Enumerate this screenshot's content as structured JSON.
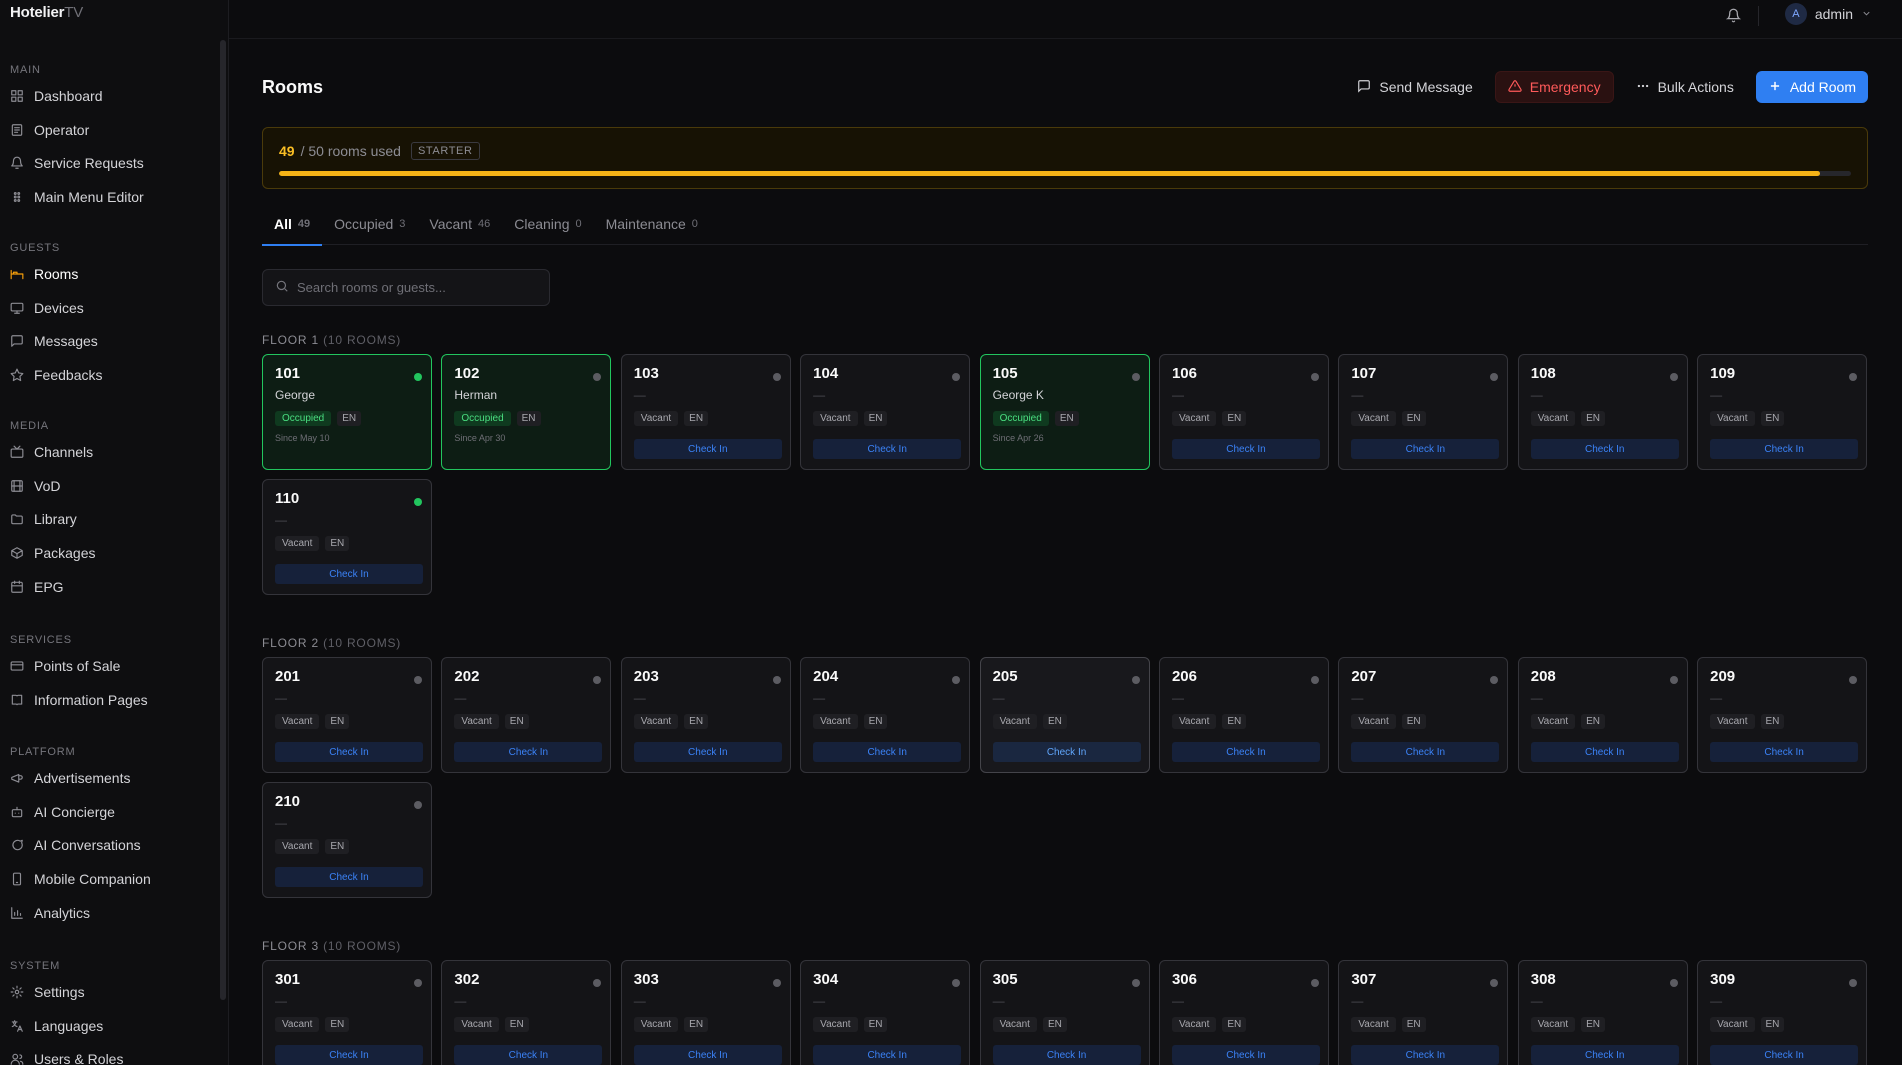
{
  "brand": {
    "name": "Hotelier",
    "suffix": "TV"
  },
  "sidebar": {
    "sections": [
      {
        "title": "MAIN",
        "items": [
          {
            "label": "Dashboard",
            "icon": "dashboard-icon"
          },
          {
            "label": "Operator",
            "icon": "operator-icon"
          },
          {
            "label": "Service Requests",
            "icon": "bell-icon"
          },
          {
            "label": "Main Menu Editor",
            "icon": "grip-icon"
          }
        ]
      },
      {
        "title": "GUESTS",
        "items": [
          {
            "label": "Rooms",
            "icon": "bed-icon",
            "active": true
          },
          {
            "label": "Devices",
            "icon": "monitor-icon"
          },
          {
            "label": "Messages",
            "icon": "message-icon"
          },
          {
            "label": "Feedbacks",
            "icon": "star-icon"
          }
        ]
      },
      {
        "title": "MEDIA",
        "items": [
          {
            "label": "Channels",
            "icon": "tv-icon"
          },
          {
            "label": "VoD",
            "icon": "film-icon"
          },
          {
            "label": "Library",
            "icon": "folder-icon"
          },
          {
            "label": "Packages",
            "icon": "package-icon"
          },
          {
            "label": "EPG",
            "icon": "calendar-icon"
          }
        ]
      },
      {
        "title": "SERVICES",
        "items": [
          {
            "label": "Points of Sale",
            "icon": "card-icon"
          },
          {
            "label": "Information Pages",
            "icon": "book-icon"
          }
        ]
      },
      {
        "title": "PLATFORM",
        "items": [
          {
            "label": "Advertisements",
            "icon": "megaphone-icon"
          },
          {
            "label": "AI Concierge",
            "icon": "bot-icon"
          },
          {
            "label": "AI Conversations",
            "icon": "chat-icon"
          },
          {
            "label": "Mobile Companion",
            "icon": "phone-icon"
          },
          {
            "label": "Analytics",
            "icon": "chart-icon"
          }
        ]
      },
      {
        "title": "SYSTEM",
        "items": [
          {
            "label": "Settings",
            "icon": "gear-icon"
          },
          {
            "label": "Languages",
            "icon": "translate-icon"
          },
          {
            "label": "Users & Roles",
            "icon": "users-icon"
          }
        ]
      }
    ]
  },
  "topbar": {
    "user_initial": "A",
    "user_name": "admin"
  },
  "page": {
    "title": "Rooms",
    "actions": {
      "send_message": "Send Message",
      "emergency": "Emergency",
      "bulk": "Bulk Actions",
      "add_room": "Add Room"
    },
    "usage": {
      "used": "49",
      "total_text": "/ 50 rooms used",
      "plan": "STARTER",
      "fraction": 0.98
    },
    "tabs": [
      {
        "label": "All",
        "count": "49",
        "active": true
      },
      {
        "label": "Occupied",
        "count": "3"
      },
      {
        "label": "Vacant",
        "count": "46"
      },
      {
        "label": "Cleaning",
        "count": "0"
      },
      {
        "label": "Maintenance",
        "count": "0"
      }
    ],
    "search_placeholder": "Search rooms or guests...",
    "check_in_label": "Check In",
    "floors": [
      {
        "title": "FLOOR 1",
        "sub": "(10 ROOMS)",
        "rooms": [
          {
            "number": "101",
            "guest": "George",
            "status": "Occupied",
            "lang": "EN",
            "since": "Since May 10",
            "dot": "green"
          },
          {
            "number": "102",
            "guest": "Herman",
            "status": "Occupied",
            "lang": "EN",
            "since": "Since Apr 30",
            "dot": "gray"
          },
          {
            "number": "103",
            "guest": "—",
            "status": "Vacant",
            "lang": "EN",
            "dot": "gray"
          },
          {
            "number": "104",
            "guest": "—",
            "status": "Vacant",
            "lang": "EN",
            "dot": "gray"
          },
          {
            "number": "105",
            "guest": "George K",
            "status": "Occupied",
            "lang": "EN",
            "since": "Since Apr 26",
            "dot": "gray"
          },
          {
            "number": "106",
            "guest": "—",
            "status": "Vacant",
            "lang": "EN",
            "dot": "gray"
          },
          {
            "number": "107",
            "guest": "—",
            "status": "Vacant",
            "lang": "EN",
            "dot": "gray"
          },
          {
            "number": "108",
            "guest": "—",
            "status": "Vacant",
            "lang": "EN",
            "dot": "gray"
          },
          {
            "number": "109",
            "guest": "—",
            "status": "Vacant",
            "lang": "EN",
            "dot": "gray"
          },
          {
            "number": "110",
            "guest": "—",
            "status": "Vacant",
            "lang": "EN",
            "dot": "green"
          }
        ]
      },
      {
        "title": "FLOOR 2",
        "sub": "(10 ROOMS)",
        "rooms": [
          {
            "number": "201",
            "guest": "—",
            "status": "Vacant",
            "lang": "EN",
            "dot": "gray"
          },
          {
            "number": "202",
            "guest": "—",
            "status": "Vacant",
            "lang": "EN",
            "dot": "gray"
          },
          {
            "number": "203",
            "guest": "—",
            "status": "Vacant",
            "lang": "EN",
            "dot": "gray"
          },
          {
            "number": "204",
            "guest": "—",
            "status": "Vacant",
            "lang": "EN",
            "dot": "gray"
          },
          {
            "number": "205",
            "guest": "—",
            "status": "Vacant",
            "lang": "EN",
            "dot": "gray",
            "highlight": true
          },
          {
            "number": "206",
            "guest": "—",
            "status": "Vacant",
            "lang": "EN",
            "dot": "gray"
          },
          {
            "number": "207",
            "guest": "—",
            "status": "Vacant",
            "lang": "EN",
            "dot": "gray"
          },
          {
            "number": "208",
            "guest": "—",
            "status": "Vacant",
            "lang": "EN",
            "dot": "gray"
          },
          {
            "number": "209",
            "guest": "—",
            "status": "Vacant",
            "lang": "EN",
            "dot": "gray"
          },
          {
            "number": "210",
            "guest": "—",
            "status": "Vacant",
            "lang": "EN",
            "dot": "gray"
          }
        ]
      },
      {
        "title": "FLOOR 3",
        "sub": "(10 ROOMS)",
        "rooms": [
          {
            "number": "301",
            "guest": "—",
            "status": "Vacant",
            "lang": "EN",
            "dot": "gray"
          },
          {
            "number": "302",
            "guest": "—",
            "status": "Vacant",
            "lang": "EN",
            "dot": "gray"
          },
          {
            "number": "303",
            "guest": "—",
            "status": "Vacant",
            "lang": "EN",
            "dot": "gray"
          },
          {
            "number": "304",
            "guest": "—",
            "status": "Vacant",
            "lang": "EN",
            "dot": "gray"
          },
          {
            "number": "305",
            "guest": "—",
            "status": "Vacant",
            "lang": "EN",
            "dot": "gray"
          },
          {
            "number": "306",
            "guest": "—",
            "status": "Vacant",
            "lang": "EN",
            "dot": "gray"
          },
          {
            "number": "307",
            "guest": "—",
            "status": "Vacant",
            "lang": "EN",
            "dot": "gray"
          },
          {
            "number": "308",
            "guest": "—",
            "status": "Vacant",
            "lang": "EN",
            "dot": "gray"
          },
          {
            "number": "309",
            "guest": "—",
            "status": "Vacant",
            "lang": "EN",
            "dot": "gray"
          }
        ]
      }
    ]
  },
  "colors": {
    "accent": "#2f7ff2",
    "warning": "#f5b316",
    "occupied": "#22c55e",
    "danger": "#ff5a5a"
  }
}
